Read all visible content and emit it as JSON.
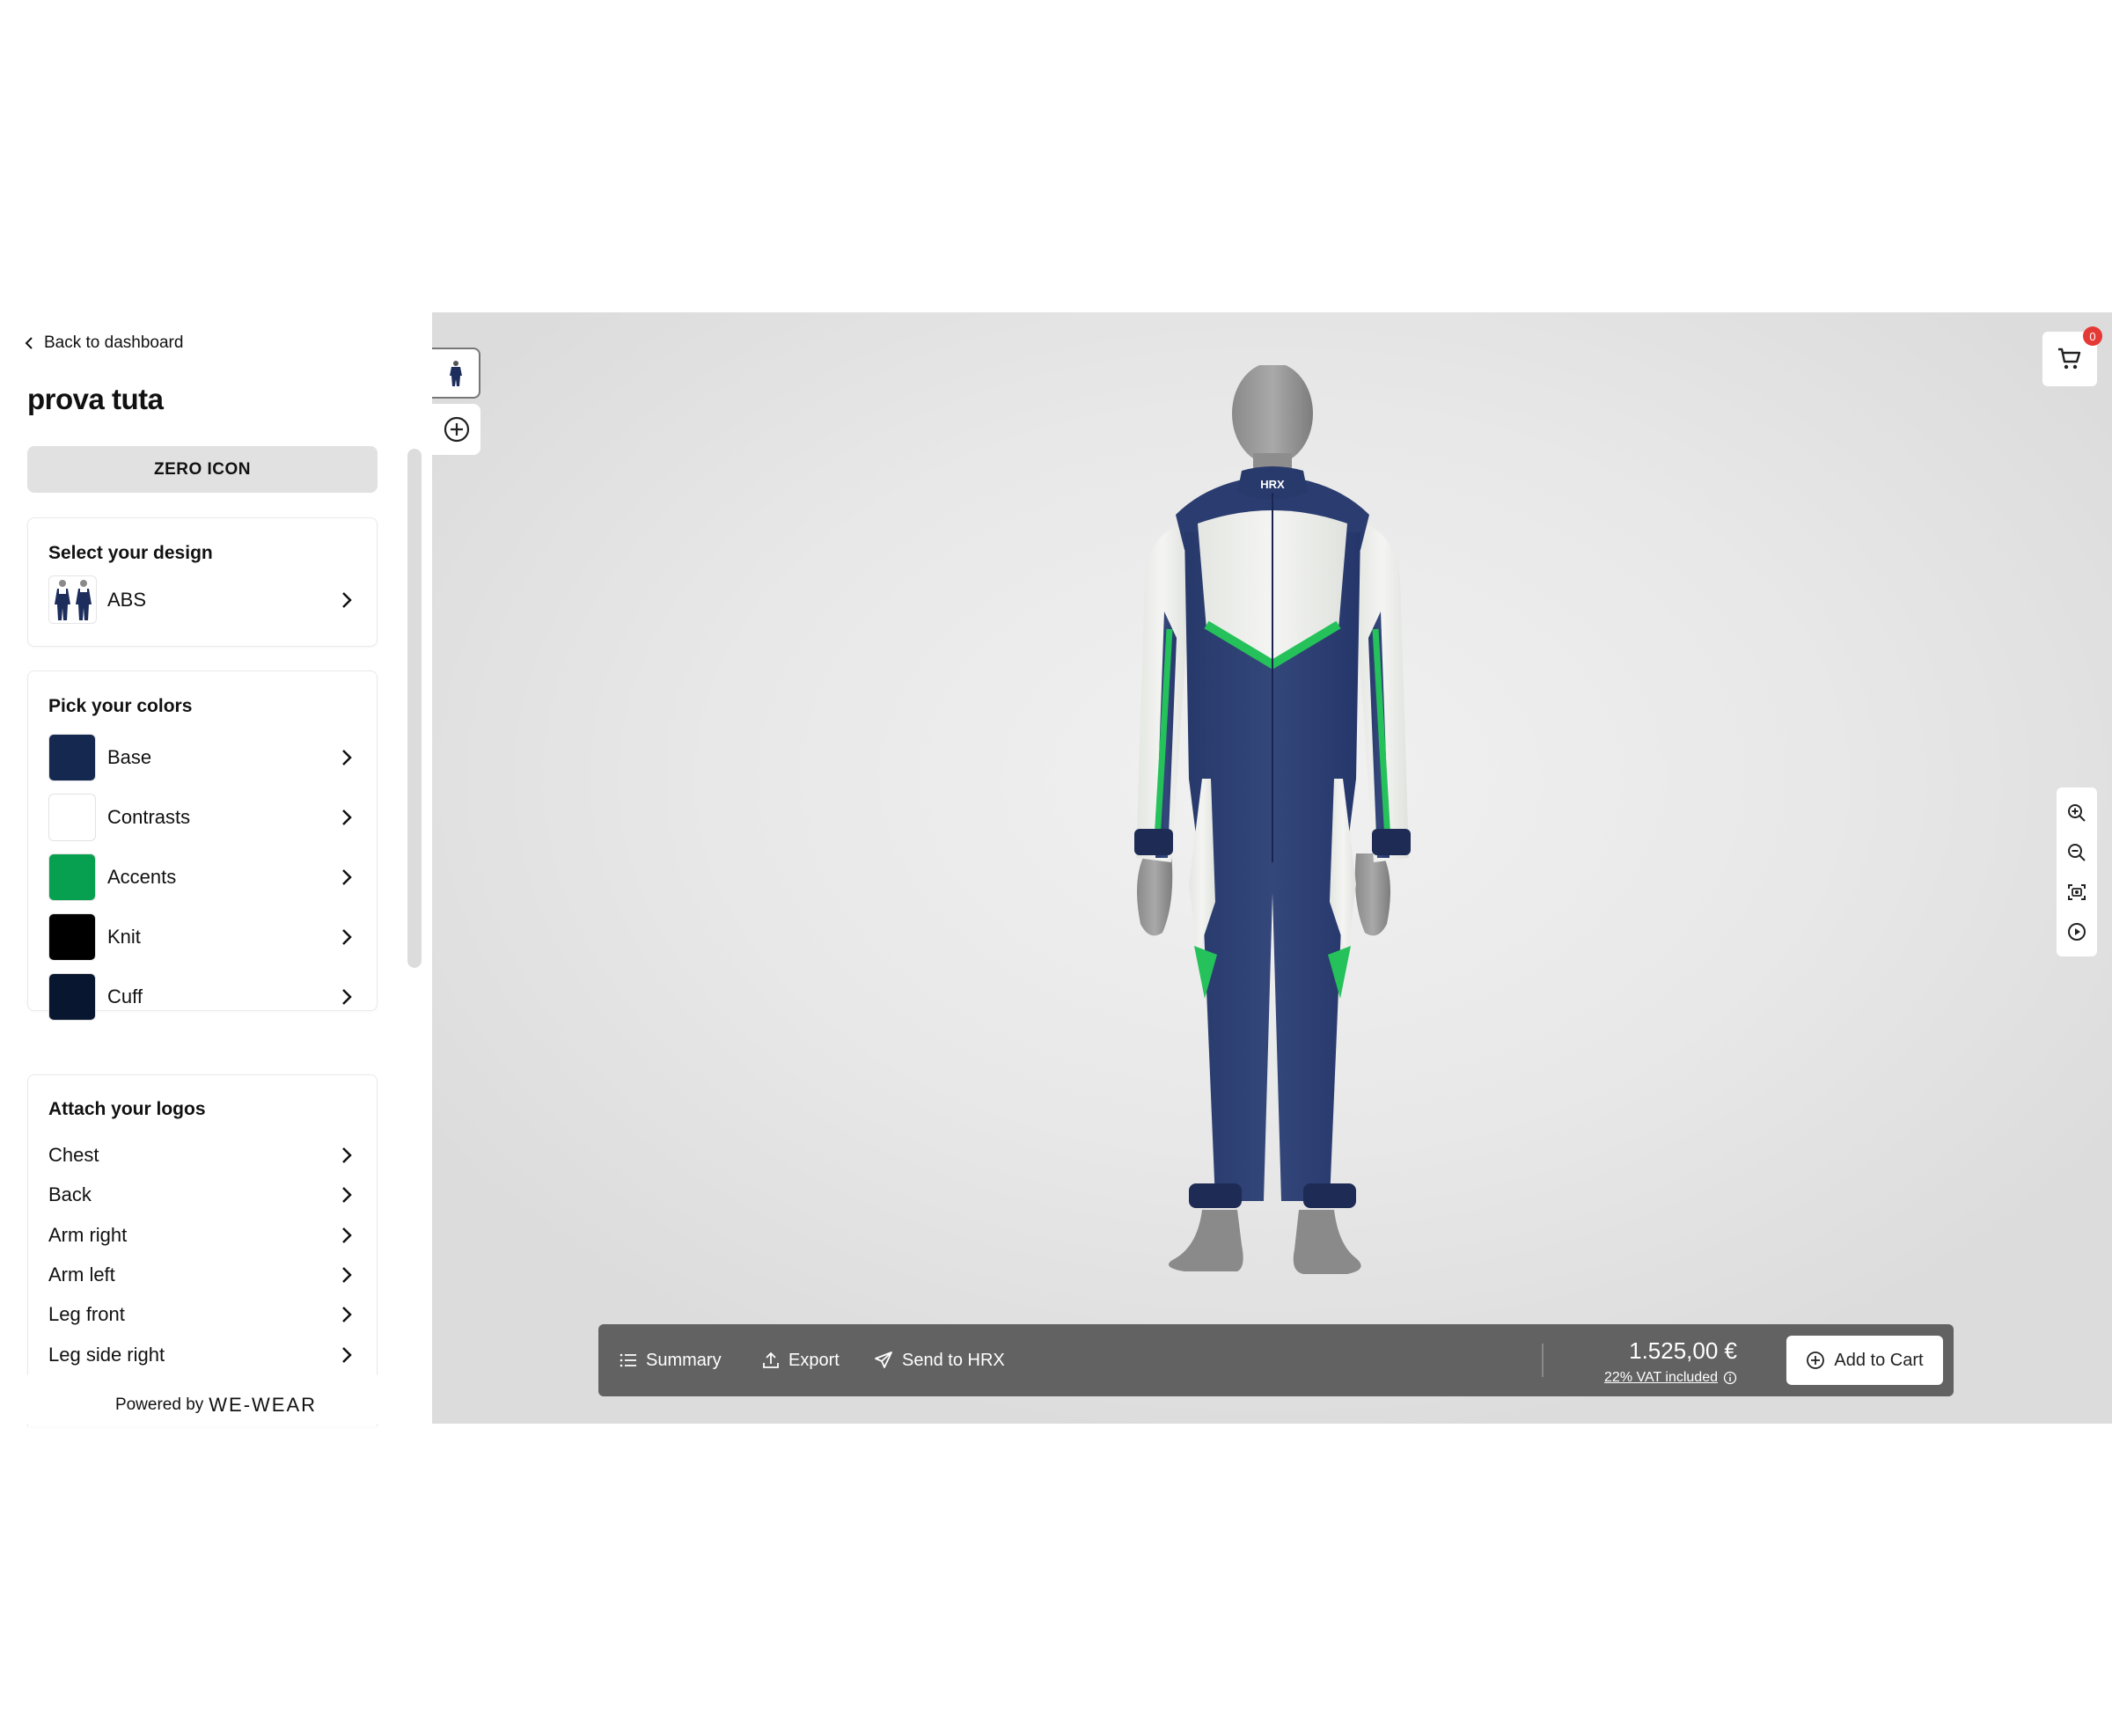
{
  "sidebar": {
    "back_label": "Back to dashboard",
    "project_title": "prova tuta",
    "model_button": "ZERO ICON",
    "design": {
      "title": "Select your design",
      "selected": "ABS"
    },
    "colors": {
      "title": "Pick your colors",
      "items": [
        {
          "label": "Base",
          "color": "#15284f"
        },
        {
          "label": "Contrasts",
          "color": "#ffffff"
        },
        {
          "label": "Accents",
          "color": "#07a050"
        },
        {
          "label": "Knit",
          "color": "#000000"
        },
        {
          "label": "Cuff",
          "color": "#08162f"
        }
      ]
    },
    "logos": {
      "title": "Attach your logos",
      "items": [
        "Chest",
        "Back",
        "Arm right",
        "Arm left",
        "Leg front",
        "Leg side right"
      ]
    },
    "powered_by": "Powered by",
    "brand": "WE-WEAR"
  },
  "viewer": {
    "cart_count": "0",
    "suit_text": "HRX",
    "tools": [
      "zoom-in-icon",
      "zoom-out-icon",
      "screenshot-icon",
      "play-icon"
    ]
  },
  "bottom_bar": {
    "summary": "Summary",
    "export": "Export",
    "send": "Send to HRX",
    "price": "1.525,00 €",
    "vat": "22% VAT included",
    "add_to_cart": "Add to Cart"
  }
}
